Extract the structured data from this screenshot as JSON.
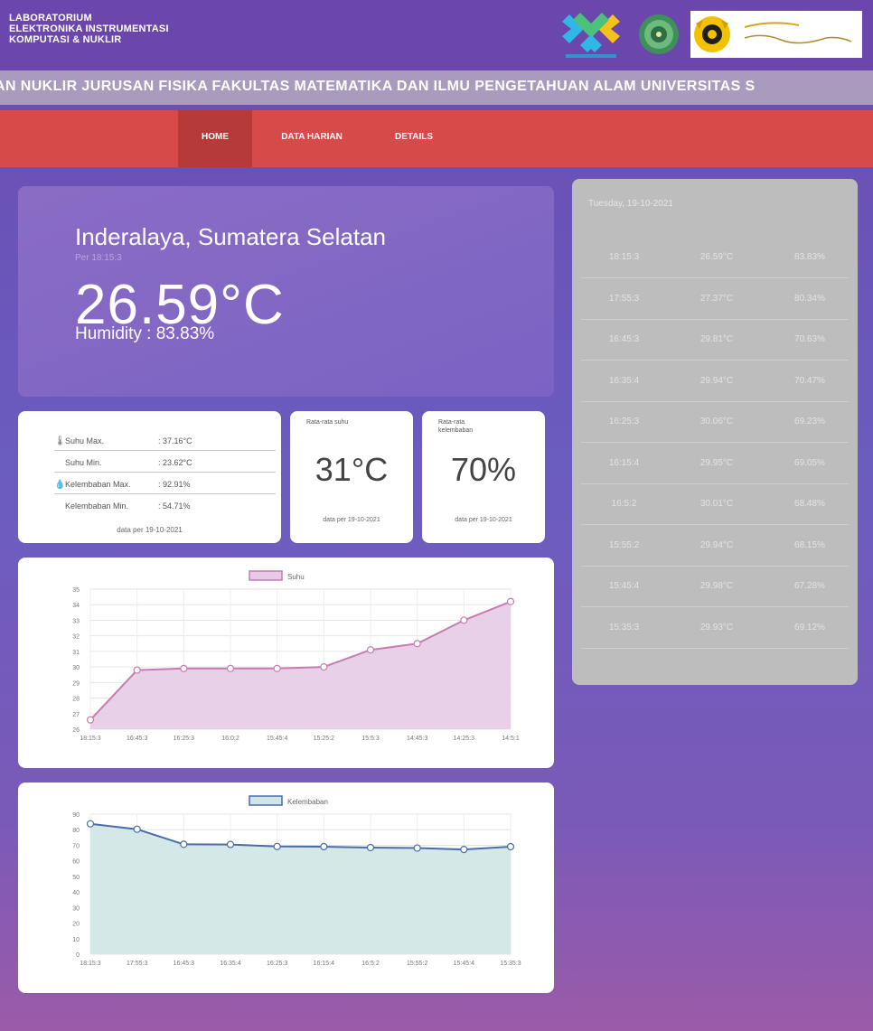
{
  "header": {
    "lab_lines": [
      "LABORATORIUM",
      "ELEKTRONIKA INSTRUMENTASI",
      "KOMPUTASI & NUKLIR"
    ]
  },
  "marquee": "AN NUKLIR JURUSAN FISIKA FAKULTAS MATEMATIKA DAN ILMU PENGETAHUAN ALAM UNIVERSITAS S",
  "nav": {
    "home": "HOME",
    "data_harian": "DATA HARIAN",
    "details": "DETAILS"
  },
  "current": {
    "location": "Inderalaya, Sumatera Selatan",
    "per": "Per 18:15:3",
    "temperature": "26.59°C",
    "humidity": "Humidity : 83.83%"
  },
  "stats": {
    "rows": [
      {
        "label": "Suhu Max.",
        "value": ": 37.16°C"
      },
      {
        "label": "Suhu Min.",
        "value": ": 23.62°C"
      },
      {
        "label": "Kelembaban Max.",
        "value": ": 92.91%"
      },
      {
        "label": "Kelembaban Min.",
        "value": ": 54.71%"
      }
    ],
    "footer": "data per 19-10-2021"
  },
  "avg_temp": {
    "label": "Rata-rata suhu",
    "value": "31°C",
    "footer": "data per 19-10-2021"
  },
  "avg_humidity": {
    "label": "Rata-rata kelembaban",
    "value": "70%",
    "footer": "data per 19-10-2021"
  },
  "colors": {
    "header": "#6b46ad",
    "nav": "#d64a4a",
    "temp_line": "#c77bb0",
    "temp_fill": "#e6cbe6",
    "humid_line": "#4a6ca8",
    "humid_fill": "#cfe6e6"
  },
  "chart_data": [
    {
      "type": "area",
      "legend": "Suhu",
      "x": [
        "18:15:3",
        "16:45:3",
        "16:25:3",
        "16:0:2",
        "15:45:4",
        "15:25:2",
        "15:5:3",
        "14:45:3",
        "14:25:3",
        "14:5:1"
      ],
      "values": [
        26.6,
        29.8,
        29.9,
        29.9,
        29.9,
        30.0,
        31.1,
        31.5,
        33.0,
        34.2
      ],
      "yticks": [
        "26",
        "27",
        "28",
        "29",
        "30",
        "31",
        "32",
        "33",
        "34",
        "35"
      ],
      "ylim": [
        26,
        35
      ]
    },
    {
      "type": "area",
      "legend": "Kelembaban",
      "x": [
        "18:15:3",
        "17:55:3",
        "16:45:3",
        "16:35:4",
        "16:25:3",
        "16:15:4",
        "16:5:2",
        "15:55:2",
        "15:45:4",
        "15:35:3"
      ],
      "values": [
        83.8,
        80.3,
        70.6,
        70.5,
        69.2,
        69.1,
        68.5,
        68.2,
        67.3,
        69.1
      ],
      "yticks": [
        "0",
        "10",
        "20",
        "30",
        "40",
        "50",
        "60",
        "70",
        "80",
        "90"
      ],
      "ylim": [
        0,
        90
      ]
    }
  ],
  "side": {
    "date": "Tuesday, 19-10-2021",
    "rows": [
      {
        "time": "18:15:3",
        "temp": "26.59°C",
        "hum": "83.83%"
      },
      {
        "time": "17:55:3",
        "temp": "27.37°C",
        "hum": "80.34%"
      },
      {
        "time": "16:45:3",
        "temp": "29.81°C",
        "hum": "70.63%"
      },
      {
        "time": "16:35:4",
        "temp": "29.94°C",
        "hum": "70.47%"
      },
      {
        "time": "16:25:3",
        "temp": "30.06°C",
        "hum": "69.23%"
      },
      {
        "time": "16:15:4",
        "temp": "29.95°C",
        "hum": "69.05%"
      },
      {
        "time": "16:5:2",
        "temp": "30.01°C",
        "hum": "68.48%"
      },
      {
        "time": "15:55:2",
        "temp": "29.94°C",
        "hum": "68.15%"
      },
      {
        "time": "15:45:4",
        "temp": "29.98°C",
        "hum": "67.28%"
      },
      {
        "time": "15:35:3",
        "temp": "29.93°C",
        "hum": "69.12%"
      }
    ]
  }
}
